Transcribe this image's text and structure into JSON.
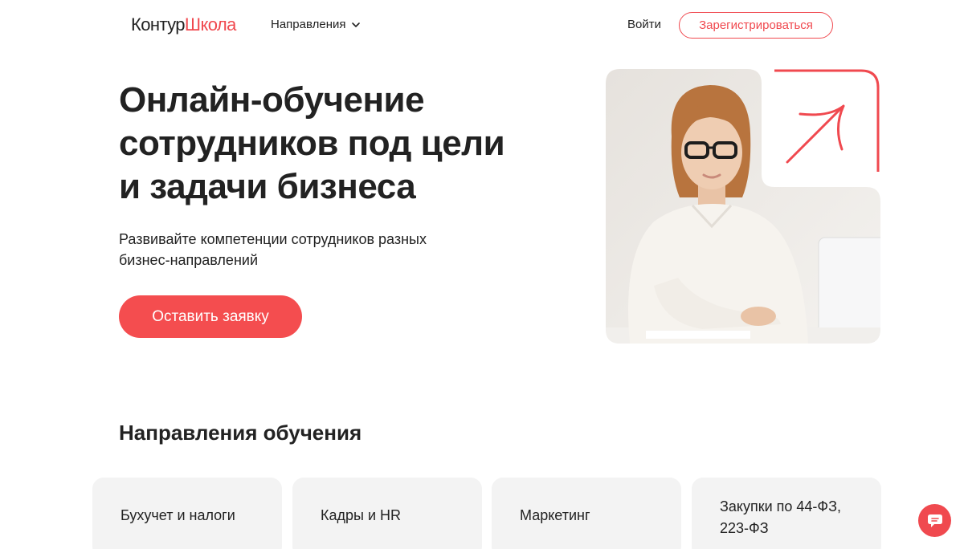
{
  "header": {
    "logo_part1": "Контур",
    "logo_part2": "Школа",
    "nav_directions": "Направления",
    "login": "Войти",
    "register": "Зарегистрироваться"
  },
  "hero": {
    "title_line1": "Онлайн-обучение",
    "title_line2": "сотрудников под цели",
    "title_line3": "и задачи бизнеса",
    "subtitle_line1": "Развивайте компетенции сотрудников разных",
    "subtitle_line2": "бизнес-направлений",
    "cta": "Оставить заявку"
  },
  "directions": {
    "title": "Направления обучения",
    "cards": [
      {
        "line1": "Бухучет и налоги",
        "line2": ""
      },
      {
        "line1": "Кадры и HR",
        "line2": ""
      },
      {
        "line1": "Маркетинг",
        "line2": ""
      },
      {
        "line1": "Закупки по 44-ФЗ,",
        "line2": "223-ФЗ"
      }
    ]
  },
  "colors": {
    "accent": "#f0494f",
    "button": "#f44d4f",
    "card_bg": "#f3f3f3",
    "text": "#222222"
  },
  "icons": {
    "nav_chevron": "chevron-down-icon",
    "deco_arrow": "arrow-up-right-icon",
    "chat": "chat-icon"
  }
}
